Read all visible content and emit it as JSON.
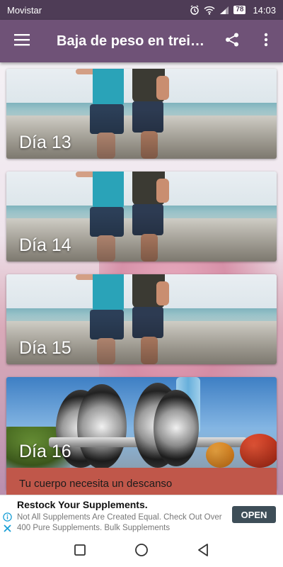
{
  "status_bar": {
    "carrier": "Movistar",
    "battery": "78",
    "time": "14:03",
    "icons": [
      "alarm-icon",
      "wifi-icon",
      "signal-icon",
      "battery-icon"
    ]
  },
  "app_bar": {
    "title": "Baja de peso en trei…",
    "icons": [
      "menu-icon",
      "share-icon",
      "more-icon"
    ],
    "color": "#6f5277"
  },
  "cards": [
    {
      "label": "Día 13"
    },
    {
      "label": "Día 14"
    },
    {
      "label": "Día 15"
    },
    {
      "label": "Día 16"
    }
  ],
  "rest_banner": "Tu cuerpo necesita un descanso",
  "ad": {
    "title": "Restock Your Supplements.",
    "body": "Not All Supplements Are Created Equal. Check Out Over 400 Pure Supplements. Bulk Supplements",
    "button": "OPEN"
  },
  "nav_bar": {
    "icons": [
      "recents-icon",
      "home-icon",
      "back-icon"
    ]
  }
}
